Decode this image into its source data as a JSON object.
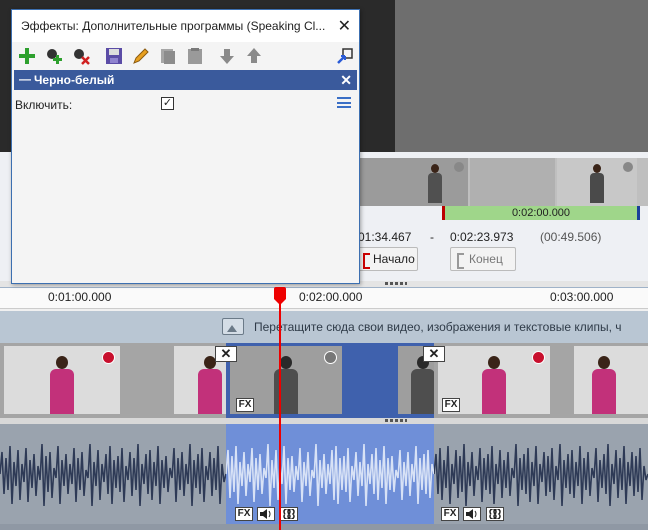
{
  "dialog": {
    "title": "Эффекты: Дополнительные программы (Speaking Cl...",
    "close_glyph": "✕",
    "toolbar": [
      "add-effect-icon",
      "add-preset-icon",
      "delete-icon",
      "save-icon",
      "edit-icon",
      "copy-icon",
      "paste-icon",
      "move-down-icon",
      "move-up-icon",
      "apply-icon"
    ],
    "effect_panel": {
      "dash": "—",
      "title": "Черно-белый",
      "close_glyph": "✕",
      "enable_label": "Включить:",
      "enable_checked": true,
      "check_glyph": "✓"
    }
  },
  "trim": {
    "range_label": "0:02:00.000",
    "start_time": "01:34.467",
    "separator": "-",
    "end_time": "0:02:23.973",
    "duration": "(00:49.506)",
    "start_button": "Начало",
    "end_button": "Конец"
  },
  "timeline": {
    "ruler_labels": [
      "0:01:00.000",
      "0:02:00.000",
      "0:03:00.000"
    ],
    "drop_hint": "Перетащите сюда свои видео, изображения и текстовые клипы, ч",
    "fx_label": "FX",
    "transition_glyph": "✕",
    "audio_icons": [
      "volume-icon",
      "loop-icon"
    ]
  },
  "colors": {
    "accent": "#3a5a9c",
    "selected_clip": "#3f61ad",
    "playhead": "#e00000",
    "range_bar": "#9fd68a"
  }
}
